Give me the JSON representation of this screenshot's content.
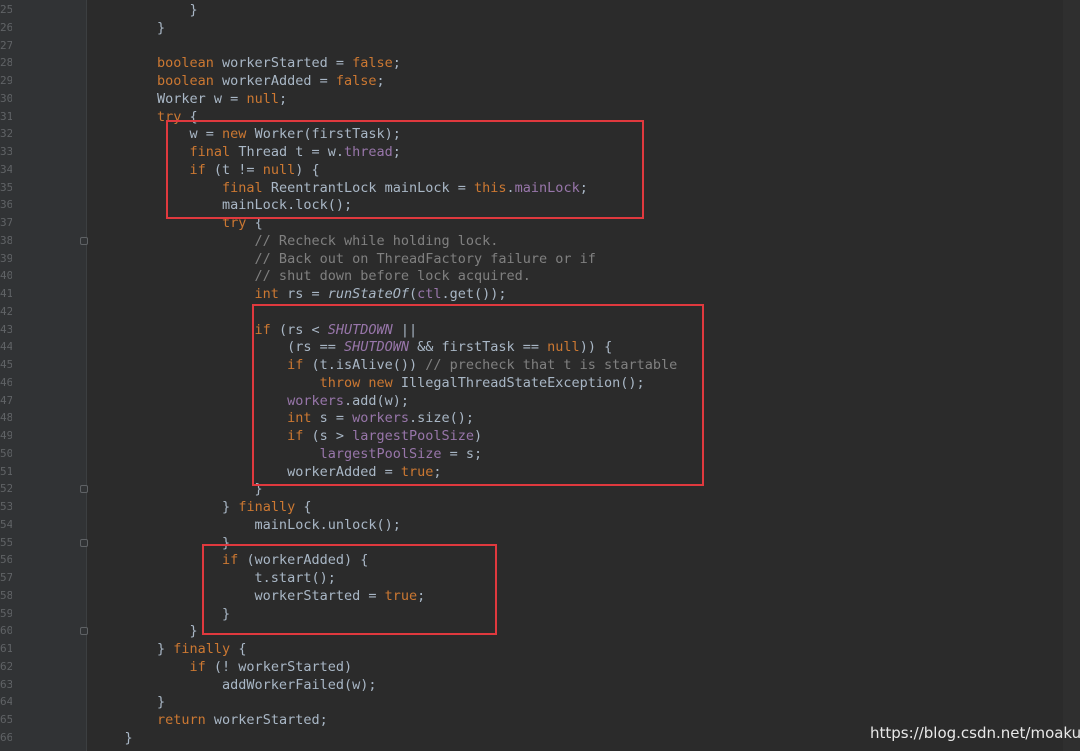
{
  "editor": {
    "lines": [
      {
        "n": "25",
        "t": [
          [
            "tx",
            "            }"
          ]
        ]
      },
      {
        "n": "26",
        "t": [
          [
            "tx",
            "        }"
          ]
        ]
      },
      {
        "n": "27",
        "t": []
      },
      {
        "n": "28",
        "t": [
          [
            "kw",
            "        boolean "
          ],
          [
            "tx",
            "workerStarted = "
          ],
          [
            "kw",
            "false"
          ],
          [
            "tx",
            ";"
          ]
        ]
      },
      {
        "n": "29",
        "t": [
          [
            "kw",
            "        boolean "
          ],
          [
            "tx",
            "workerAdded = "
          ],
          [
            "kw",
            "false"
          ],
          [
            "tx",
            ";"
          ]
        ]
      },
      {
        "n": "30",
        "t": [
          [
            "tx",
            "        Worker w = "
          ],
          [
            "kw",
            "null"
          ],
          [
            "tx",
            ";"
          ]
        ]
      },
      {
        "n": "31",
        "t": [
          [
            "kw",
            "        try "
          ],
          [
            "tx",
            "{"
          ]
        ]
      },
      {
        "n": "32",
        "t": [
          [
            "tx",
            "            w = "
          ],
          [
            "kw",
            "new "
          ],
          [
            "tx",
            "Worker(firstTask);"
          ]
        ]
      },
      {
        "n": "33",
        "t": [
          [
            "kw",
            "            final "
          ],
          [
            "tx",
            "Thread t = w."
          ],
          [
            "fd",
            "thread"
          ],
          [
            "tx",
            ";"
          ]
        ]
      },
      {
        "n": "34",
        "t": [
          [
            "kw",
            "            if "
          ],
          [
            "tx",
            "(t != "
          ],
          [
            "kw",
            "null"
          ],
          [
            "tx",
            ") {"
          ]
        ]
      },
      {
        "n": "35",
        "t": [
          [
            "kw",
            "                final "
          ],
          [
            "tx",
            "ReentrantLock mainLock = "
          ],
          [
            "kw",
            "this"
          ],
          [
            "tx",
            "."
          ],
          [
            "fd",
            "mainLock"
          ],
          [
            "tx",
            ";"
          ]
        ]
      },
      {
        "n": "36",
        "t": [
          [
            "tx",
            "                mainLock.lock();"
          ]
        ]
      },
      {
        "n": "37",
        "t": [
          [
            "kw",
            "                try "
          ],
          [
            "tx",
            "{"
          ]
        ]
      },
      {
        "n": "38",
        "t": [
          [
            "cm",
            "                    // Recheck while holding lock."
          ]
        ]
      },
      {
        "n": "39",
        "t": [
          [
            "cm",
            "                    // Back out on ThreadFactory failure or if"
          ]
        ]
      },
      {
        "n": "40",
        "t": [
          [
            "cm",
            "                    // shut down before lock acquired."
          ]
        ]
      },
      {
        "n": "41",
        "t": [
          [
            "kw",
            "                    int "
          ],
          [
            "tx",
            "rs = "
          ],
          [
            "it",
            "runStateOf"
          ],
          [
            "tx",
            "("
          ],
          [
            "fd",
            "ctl"
          ],
          [
            "tx",
            ".get());"
          ]
        ]
      },
      {
        "n": "42",
        "t": []
      },
      {
        "n": "43",
        "t": [
          [
            "kw",
            "                    if "
          ],
          [
            "tx",
            "(rs < "
          ],
          [
            "fdi",
            "SHUTDOWN"
          ],
          [
            "tx",
            " ||"
          ]
        ]
      },
      {
        "n": "44",
        "t": [
          [
            "tx",
            "                        (rs == "
          ],
          [
            "fdi",
            "SHUTDOWN"
          ],
          [
            "tx",
            " && firstTask == "
          ],
          [
            "kw",
            "null"
          ],
          [
            "tx",
            ")) {"
          ]
        ]
      },
      {
        "n": "45",
        "t": [
          [
            "kw",
            "                        if "
          ],
          [
            "tx",
            "(t.isAlive()) "
          ],
          [
            "cm",
            "// precheck that t is startable"
          ]
        ]
      },
      {
        "n": "46",
        "t": [
          [
            "kw",
            "                            throw new "
          ],
          [
            "tx",
            "IllegalThreadStateException();"
          ]
        ]
      },
      {
        "n": "47",
        "t": [
          [
            "fd",
            "                        workers"
          ],
          [
            "tx",
            ".add(w);"
          ]
        ]
      },
      {
        "n": "48",
        "t": [
          [
            "kw",
            "                        int "
          ],
          [
            "tx",
            "s = "
          ],
          [
            "fd",
            "workers"
          ],
          [
            "tx",
            ".size();"
          ]
        ]
      },
      {
        "n": "49",
        "t": [
          [
            "kw",
            "                        if "
          ],
          [
            "tx",
            "(s > "
          ],
          [
            "fd",
            "largestPoolSize"
          ],
          [
            "tx",
            ")"
          ]
        ]
      },
      {
        "n": "50",
        "t": [
          [
            "fd",
            "                            largestPoolSize"
          ],
          [
            "tx",
            " = s;"
          ]
        ]
      },
      {
        "n": "51",
        "t": [
          [
            "tx",
            "                        workerAdded = "
          ],
          [
            "kw",
            "true"
          ],
          [
            "tx",
            ";"
          ]
        ]
      },
      {
        "n": "52",
        "t": [
          [
            "tx",
            "                    }"
          ]
        ]
      },
      {
        "n": "53",
        "t": [
          [
            "tx",
            "                } "
          ],
          [
            "kw",
            "finally "
          ],
          [
            "tx",
            "{"
          ]
        ]
      },
      {
        "n": "54",
        "t": [
          [
            "tx",
            "                    mainLock.unlock();"
          ]
        ]
      },
      {
        "n": "55",
        "t": [
          [
            "tx",
            "                }"
          ]
        ]
      },
      {
        "n": "56",
        "t": [
          [
            "kw",
            "                if "
          ],
          [
            "tx",
            "(workerAdded) {"
          ]
        ]
      },
      {
        "n": "57",
        "t": [
          [
            "tx",
            "                    t.start();"
          ]
        ]
      },
      {
        "n": "58",
        "t": [
          [
            "tx",
            "                    workerStarted = "
          ],
          [
            "kw",
            "true"
          ],
          [
            "tx",
            ";"
          ]
        ]
      },
      {
        "n": "59",
        "t": [
          [
            "tx",
            "                }"
          ]
        ]
      },
      {
        "n": "60",
        "t": [
          [
            "tx",
            "            }"
          ]
        ]
      },
      {
        "n": "61",
        "t": [
          [
            "tx",
            "        } "
          ],
          [
            "kw",
            "finally "
          ],
          [
            "tx",
            "{"
          ]
        ]
      },
      {
        "n": "62",
        "t": [
          [
            "kw",
            "            if "
          ],
          [
            "tx",
            "(! workerStarted)"
          ]
        ]
      },
      {
        "n": "63",
        "t": [
          [
            "tx",
            "                addWorkerFailed(w);"
          ]
        ]
      },
      {
        "n": "64",
        "t": [
          [
            "tx",
            "        }"
          ]
        ]
      },
      {
        "n": "65",
        "t": [
          [
            "kw",
            "        return "
          ],
          [
            "tx",
            "workerStarted;"
          ]
        ]
      },
      {
        "n": "66",
        "t": [
          [
            "tx",
            "    }"
          ]
        ]
      }
    ]
  },
  "watermark": {
    "text": "https://blog.csdn.net/moakun"
  },
  "colors": {
    "background": "#2b2b2b",
    "gutter": "#313335",
    "keyword": "#cc7832",
    "text": "#a9b7c6",
    "field": "#9876aa",
    "comment": "#808080",
    "line_number": "#606366",
    "highlight_box": "#e0393e"
  },
  "icons": {
    "fold_marker": "fold-marker-icon"
  }
}
